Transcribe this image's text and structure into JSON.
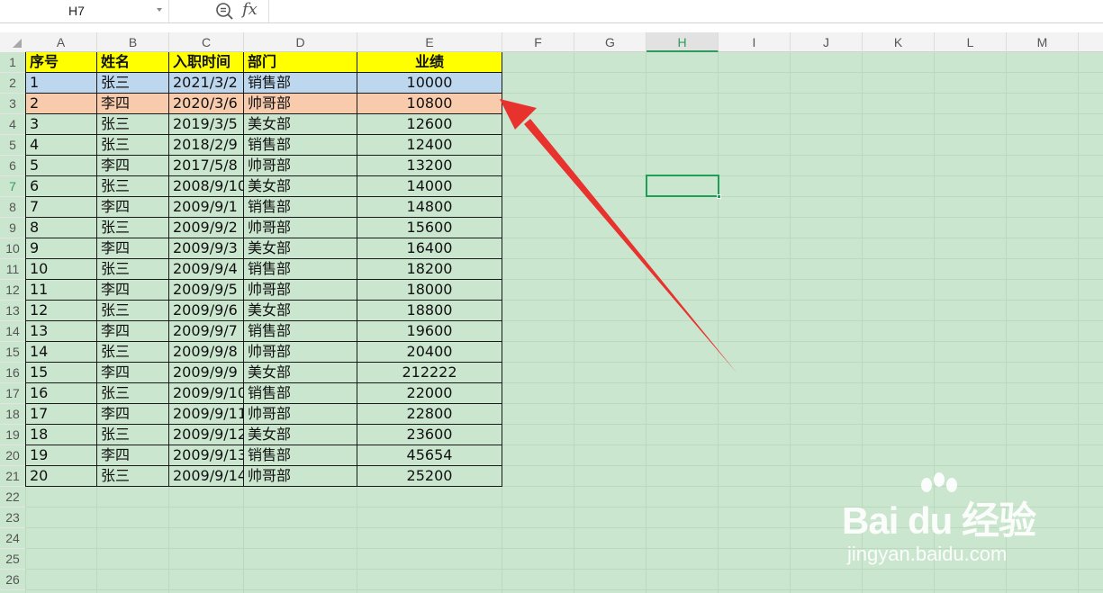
{
  "formula_bar": {
    "name_box": "H7",
    "fx_label": "fx",
    "formula": ""
  },
  "columns": [
    "A",
    "B",
    "C",
    "D",
    "E",
    "F",
    "G",
    "H",
    "I",
    "J",
    "K",
    "L",
    "M"
  ],
  "active_column": "H",
  "rows": [
    "1",
    "2",
    "3",
    "4",
    "5",
    "6",
    "7",
    "8",
    "9",
    "10",
    "11",
    "12",
    "13",
    "14",
    "15",
    "16",
    "17",
    "18",
    "19",
    "20",
    "21",
    "22",
    "23",
    "24",
    "25",
    "26"
  ],
  "active_row": "7",
  "table": {
    "headers": [
      "序号",
      "姓名",
      "入职时间",
      "部门",
      "业绩"
    ],
    "rows": [
      [
        "1",
        "张三",
        "2021/3/2",
        "销售部",
        "10000"
      ],
      [
        "2",
        "李四",
        "2020/3/6",
        "帅哥部",
        "10800"
      ],
      [
        "3",
        "张三",
        "2019/3/5",
        "美女部",
        "12600"
      ],
      [
        "4",
        "张三",
        "2018/2/9",
        "销售部",
        "12400"
      ],
      [
        "5",
        "李四",
        "2017/5/8",
        "帅哥部",
        "13200"
      ],
      [
        "6",
        "张三",
        "2008/9/10",
        "美女部",
        "14000"
      ],
      [
        "7",
        "李四",
        "2009/9/1",
        "销售部",
        "14800"
      ],
      [
        "8",
        "张三",
        "2009/9/2",
        "帅哥部",
        "15600"
      ],
      [
        "9",
        "李四",
        "2009/9/3",
        "美女部",
        "16400"
      ],
      [
        "10",
        "张三",
        "2009/9/4",
        "销售部",
        "18200"
      ],
      [
        "11",
        "李四",
        "2009/9/5",
        "帅哥部",
        "18000"
      ],
      [
        "12",
        "张三",
        "2009/9/6",
        "美女部",
        "18800"
      ],
      [
        "13",
        "李四",
        "2009/9/7",
        "销售部",
        "19600"
      ],
      [
        "14",
        "张三",
        "2009/9/8",
        "帅哥部",
        "20400"
      ],
      [
        "15",
        "李四",
        "2009/9/9",
        "美女部",
        "212222"
      ],
      [
        "16",
        "张三",
        "2009/9/10",
        "销售部",
        "22000"
      ],
      [
        "17",
        "李四",
        "2009/9/11",
        "帅哥部",
        "22800"
      ],
      [
        "18",
        "张三",
        "2009/9/12",
        "美女部",
        "23600"
      ],
      [
        "19",
        "李四",
        "2009/9/13",
        "销售部",
        "45654"
      ],
      [
        "20",
        "张三",
        "2009/9/14",
        "帅哥部",
        "25200"
      ]
    ],
    "highlighted_rows": {
      "blue": 1,
      "orange": 2
    }
  },
  "colors": {
    "sheet_background": "#cbe6cf",
    "header_fill": "#ffff00",
    "row_highlight_blue": "#bdd7ee",
    "row_highlight_orange": "#f8cbad",
    "selection": "#1f9e57",
    "arrow": "#e8322e"
  },
  "watermark": {
    "logo_text": "Bai du 经验",
    "url": "jingyan.baidu.com"
  }
}
